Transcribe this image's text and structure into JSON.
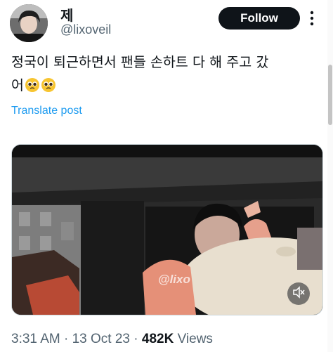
{
  "author": {
    "display_name": "제",
    "handle": "@lixoveil",
    "avatar_icon": "profile-photo"
  },
  "follow_label": "Follow",
  "more_icon": "more-dots-icon",
  "tweet": {
    "text_line1": "정국이 퇴근하면서 팬들 손하트 다 해 주고 갔",
    "text_line2": "어",
    "emojis": [
      "pleading-face",
      "pleading-face"
    ]
  },
  "translate_label": "Translate post",
  "media": {
    "type": "video",
    "watermark": "@lixo",
    "mute_icon": "speaker-muted-icon"
  },
  "meta": {
    "time": "3:31 AM",
    "separator": " · ",
    "date": "13 Oct 23",
    "views_count": "482K",
    "views_label": " Views"
  },
  "colors": {
    "text": "#0f1419",
    "secondary": "#536471",
    "link": "#1d9bf0",
    "button_bg": "#0f1419"
  }
}
